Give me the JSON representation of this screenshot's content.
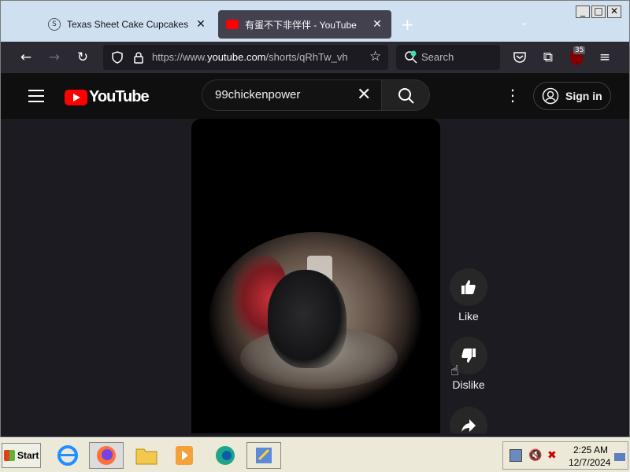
{
  "tabs": [
    {
      "title": "Texas Sheet Cake Cupcakes Rec",
      "favicon": "s-circle-icon"
    },
    {
      "title": "有蛋不下非伴伴 - YouTube",
      "favicon": "youtube-icon"
    }
  ],
  "address_bar": {
    "url_prefix": "https://www.",
    "url_domain": "youtube.com",
    "url_rest": "/shorts/qRhTw_vh"
  },
  "search_box": {
    "label": "Search"
  },
  "extension_badge": "35",
  "youtube": {
    "logo_text": "YouTube",
    "search_value": "99chickenpower",
    "signin_label": "Sign in"
  },
  "actions": {
    "like_label": "Like",
    "dislike_label": "Dislike"
  },
  "taskbar": {
    "start_label": "Start",
    "time": "2:25 AM",
    "date": "12/7/2024"
  },
  "colors": {
    "youtube_red": "#ff0000",
    "background": "#0f0f0f",
    "active_tab": "#42414d"
  }
}
